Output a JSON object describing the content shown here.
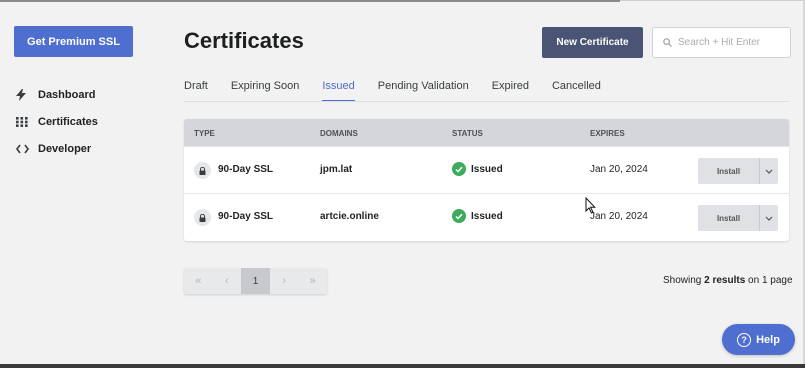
{
  "sidebar": {
    "premium_button": "Get Premium SSL",
    "items": [
      {
        "label": "Dashboard",
        "icon": "bolt-icon"
      },
      {
        "label": "Certificates",
        "icon": "grid-icon"
      },
      {
        "label": "Developer",
        "icon": "code-icon"
      }
    ]
  },
  "header": {
    "title": "Certificates",
    "new_button": "New Certificate",
    "search_placeholder": "Search + Hit Enter"
  },
  "tabs": [
    {
      "label": "Draft",
      "active": false
    },
    {
      "label": "Expiring Soon",
      "active": false
    },
    {
      "label": "Issued",
      "active": true
    },
    {
      "label": "Pending Validation",
      "active": false
    },
    {
      "label": "Expired",
      "active": false
    },
    {
      "label": "Cancelled",
      "active": false
    }
  ],
  "table": {
    "columns": [
      "TYPE",
      "DOMAINS",
      "STATUS",
      "EXPIRES"
    ],
    "rows": [
      {
        "type": "90-Day SSL",
        "domain": "jpm.lat",
        "status": "Issued",
        "expires": "Jan 20, 2024",
        "action": "Install"
      },
      {
        "type": "90-Day SSL",
        "domain": "artcie.online",
        "status": "Issued",
        "expires": "Jan 20, 2024",
        "action": "Install"
      }
    ]
  },
  "pagination": {
    "first": "«",
    "prev": "‹",
    "current_page": "1",
    "next": "›",
    "last": "»"
  },
  "results": {
    "prefix": "Showing ",
    "count": "2 results",
    "suffix": " on 1 page"
  },
  "help": {
    "label": "Help"
  },
  "colors": {
    "accent": "#4e6ed0",
    "dark_button": "#4a5474",
    "success": "#3dab5c"
  }
}
